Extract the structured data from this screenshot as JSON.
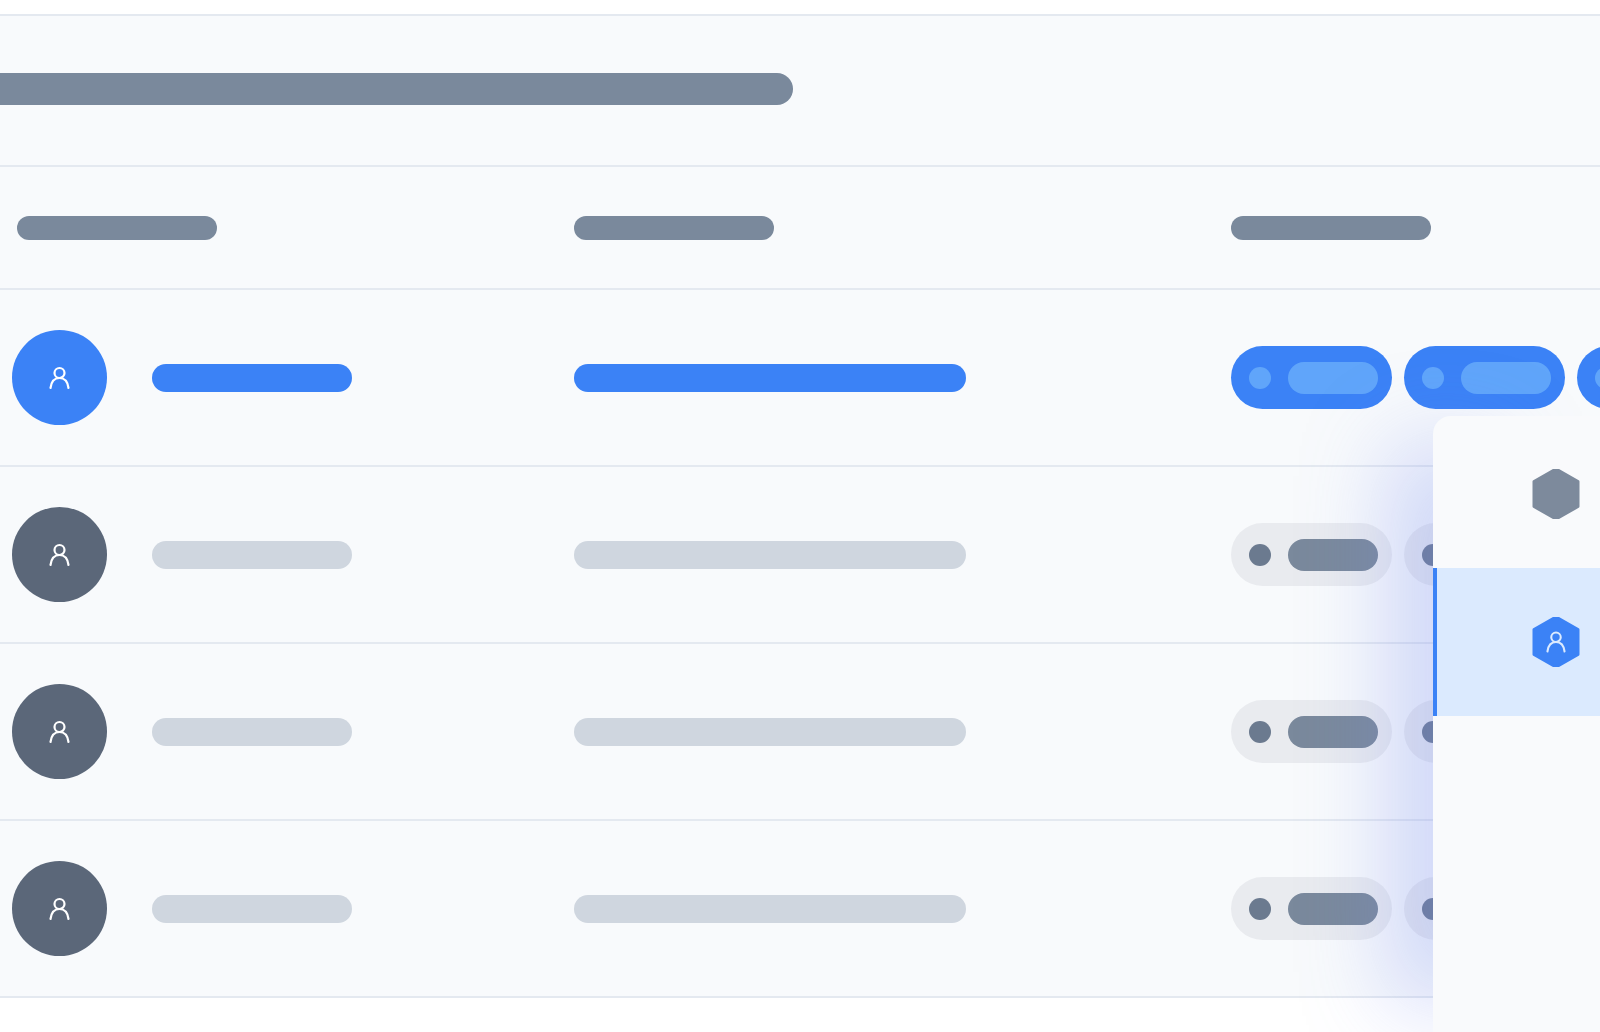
{
  "table": {
    "rows": [
      {
        "selected": true
      },
      {
        "selected": false
      },
      {
        "selected": false
      },
      {
        "selected": false
      }
    ]
  },
  "menu": {
    "items": [
      {
        "selected": false
      },
      {
        "selected": true
      }
    ]
  }
}
